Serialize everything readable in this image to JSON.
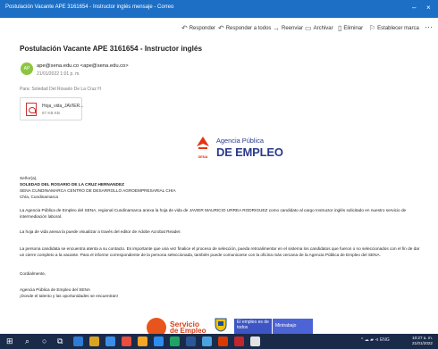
{
  "window": {
    "title": "Postulación Vacante APE 3161654 - Instructor inglés mensaje - Correo",
    "minimize": "–",
    "close": "×"
  },
  "toolbar": {
    "reply": "Responder",
    "reply_all": "Responder a todos",
    "forward": "Reenviar",
    "archive": "Archivar",
    "delete": "Eliminar",
    "flag": "Establecer marca",
    "more": "···"
  },
  "message": {
    "subject": "Postulación Vacante APE 3161654 - Instructor inglés",
    "avatar_initials": "AP",
    "sender": "ape@sena.edu.co <ape@sena.edu.co>",
    "sent": "21/01/2022 1:01 p. m.",
    "to": "Para: Soledad Del Rosario De La Cruz H",
    "attachment": {
      "name": "Hoja_vida_JAVIER...",
      "size": "67 KB KB"
    }
  },
  "logo": {
    "sena": "SENA",
    "line1": "Agencia Pública",
    "line2": "DE EMPLEO"
  },
  "body": {
    "greeting": "Señor(a),",
    "recipient_name": "SOLEDAD DEL ROSARIO DE LA CRUZ HERNANDEZ",
    "center": "SENA CUNDINAMARCA CENTRO DE DESARROLLO AGROEMPRESARIAL CHIA",
    "city": "Chía, Cundinamarca",
    "p1_line1": "La Agencia Pública de Empleo del SENA, regional Cundinamarca anexa la hoja de vida de JAVIER MAURICIO URREA RODRIGUEZ como candidato al cargo Instructor inglés solicitado en nuestro servicio de",
    "p1_line2": "intermediación laboral.",
    "p2": "La hoja de vida anexa la puede visualizar a través del editor de Adobe Acrobat Reader.",
    "p3_line1": "La persona candidata se encuentra atenta a su contacto. Es importante que una vez finalice el proceso de selección, pueda retroalimentar en el sistema los candidatos que fueron o no seleccionados con el fin de dar",
    "p3_line2": "un cierre completo a la vacante. Para el informe correspondiente de la persona seleccionada, también puede comunicarse con la oficina más cercana de la Agencia Pública de Empleo del SENA.",
    "closing": "Cordialmente,",
    "sig1": "Agencia Pública de Empleo del SENA",
    "sig2": "¡Donde el talento y las oportunidades se encuentran!"
  },
  "footer": {
    "brand_line1": "Servicio",
    "brand_line2": "de Empleo",
    "banner1": "El empleo es de todos",
    "banner2": "Mintrabajo"
  },
  "taskbar": {
    "tray": "^ ☁ ▰ ⊲ ENG",
    "time": "10:27 a. m.",
    "date": "21/01/2022"
  }
}
